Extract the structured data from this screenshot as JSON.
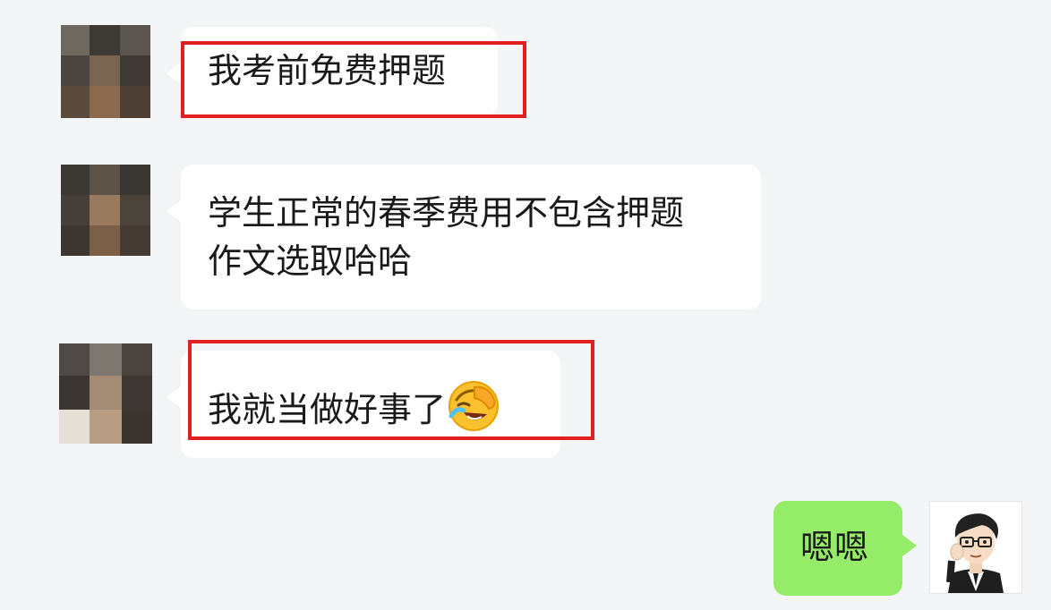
{
  "colors": {
    "background": "#f4f5f6",
    "incoming_bubble": "#ffffff",
    "outgoing_bubble": "#95ec69",
    "highlight_border": "#e02020",
    "text": "#1a1a1a"
  },
  "messages": [
    {
      "side": "incoming",
      "text": "我考前免费押题",
      "highlighted": true,
      "avatar": "pixelated-contact-avatar"
    },
    {
      "side": "incoming",
      "text": "学生正常的春季费用不包含押题\n作文选取哈哈",
      "highlighted": false,
      "avatar": "pixelated-contact-avatar"
    },
    {
      "side": "incoming",
      "text": "我就当做好事了",
      "emoji": "face-palm-laughing-emoji",
      "highlighted": true,
      "avatar": "pixelated-contact-avatar"
    },
    {
      "side": "outgoing",
      "text": "嗯嗯",
      "highlighted": false,
      "avatar": "cartoon-man-avatar"
    }
  ]
}
